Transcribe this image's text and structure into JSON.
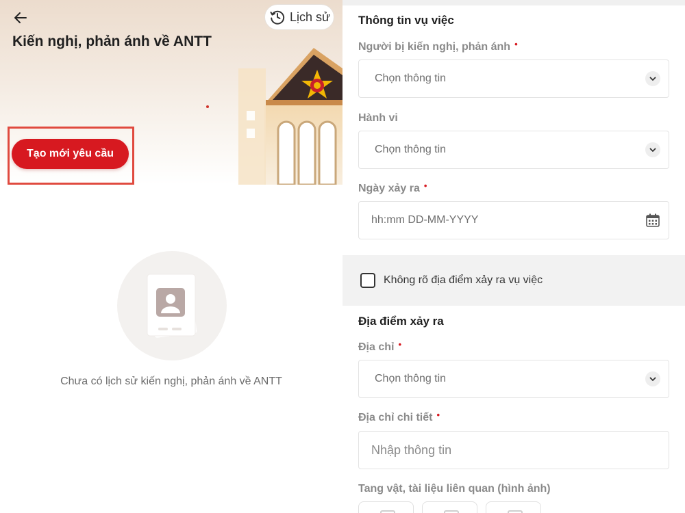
{
  "left": {
    "header": {
      "back_icon": "arrow-left-icon",
      "history_label": "Lịch sử",
      "history_icon": "clock-history-icon",
      "title": "Kiến nghị, phản ánh về ANTT"
    },
    "create_button_label": "Tạo mới yêu cầu",
    "empty_state_text": "Chưa có lịch sử kiến nghị, phản ánh về ANTT",
    "colors": {
      "accent": "#d71920",
      "highlight_box": "#e04a3f"
    }
  },
  "right": {
    "section_incident_title": "Thông tin vụ việc",
    "fields": {
      "person": {
        "label": "Người bị kiến nghị, phản ánh",
        "required_mark": "•",
        "placeholder": "Chọn thông tin"
      },
      "behavior": {
        "label": "Hành vi",
        "placeholder": "Chọn thông tin"
      },
      "date": {
        "label": "Ngày xảy ra",
        "required_mark": "•",
        "placeholder": "hh:mm DD-MM-YYYY",
        "icon": "calendar-icon"
      },
      "unknown_location": {
        "label": "Không rõ địa điểm xảy ra vụ việc",
        "checked": false
      },
      "address": {
        "label": "Địa chỉ",
        "required_mark": "•",
        "placeholder": "Chọn thông tin"
      },
      "address_detail": {
        "label": "Địa chỉ chi tiết",
        "required_mark": "•",
        "placeholder": "Nhập thông tin"
      },
      "evidence": {
        "label": "Tang vật, tài liệu liên quan (hình ảnh)"
      }
    },
    "section_location_title": "Địa điểm xảy ra"
  }
}
